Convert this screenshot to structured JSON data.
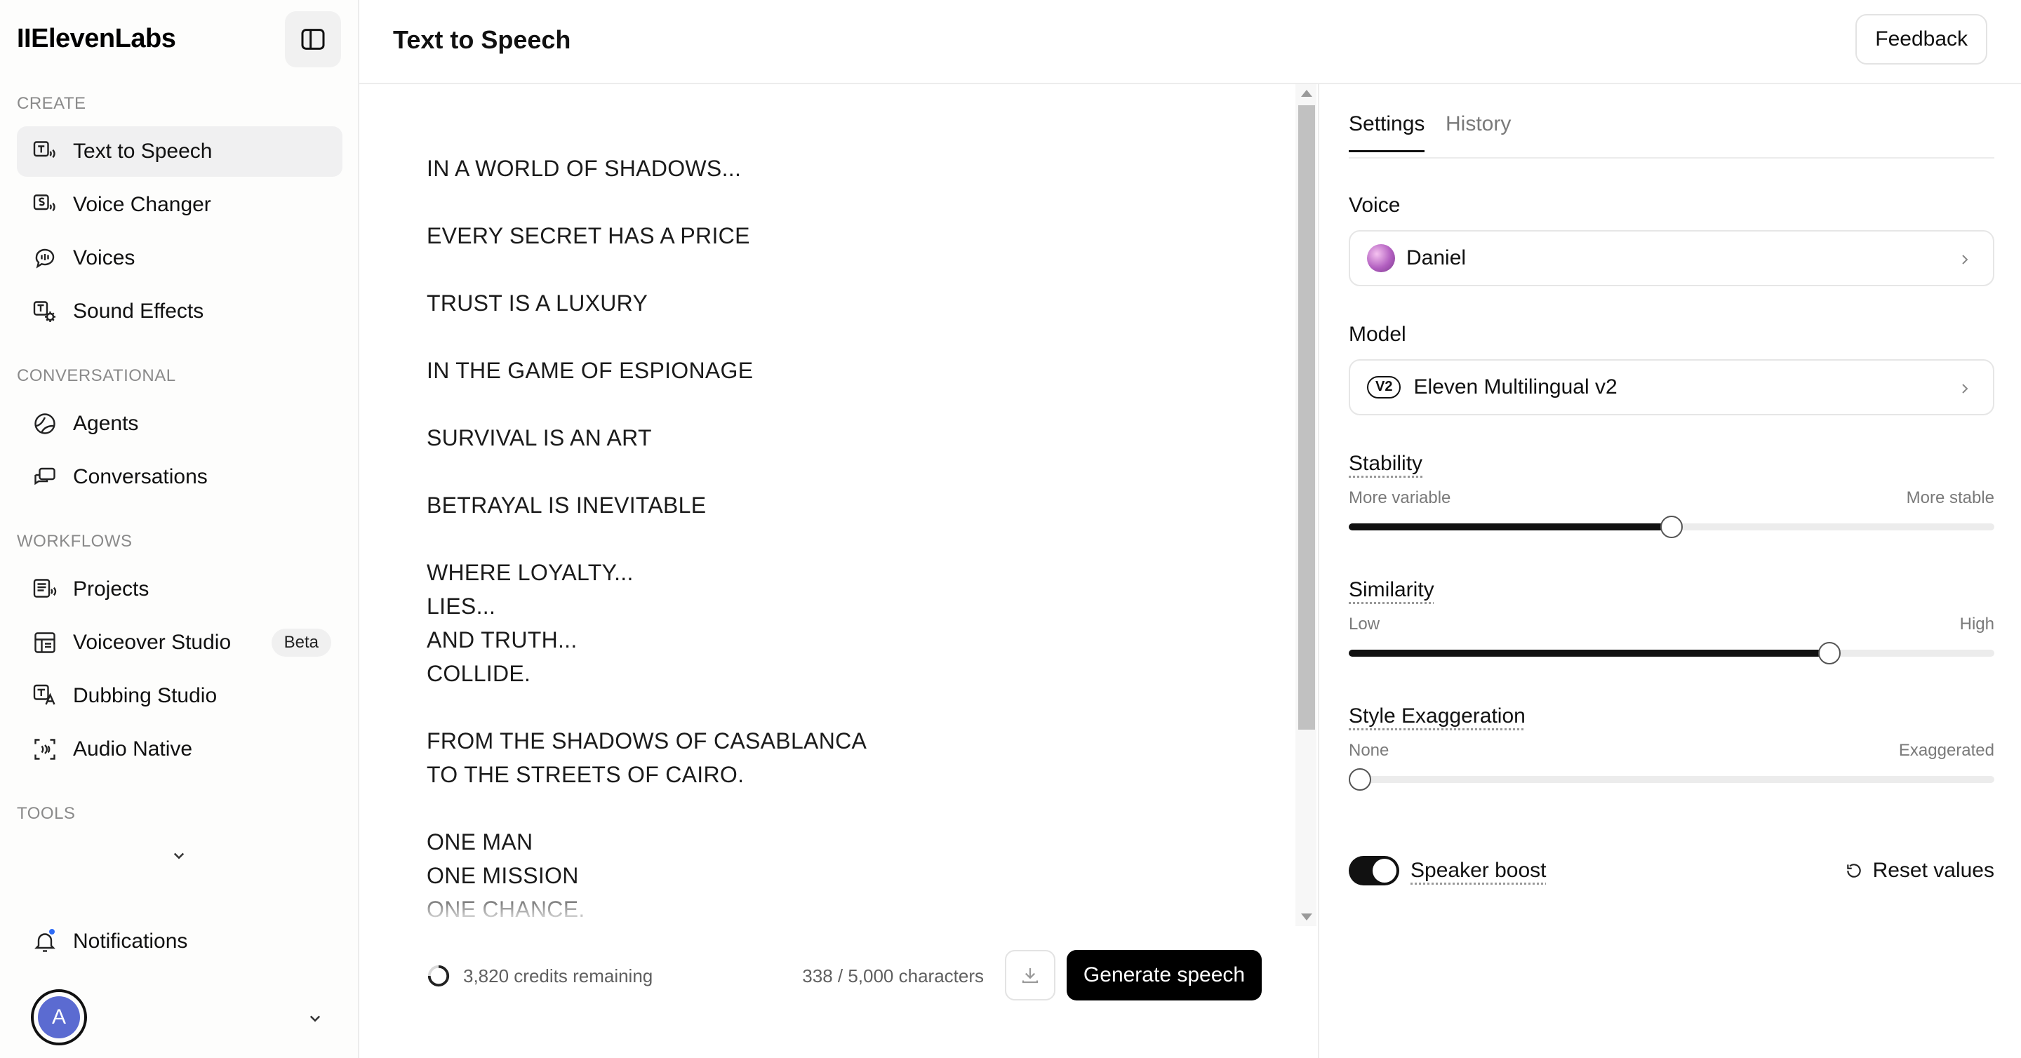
{
  "app": {
    "logo": "IIElevenLabs"
  },
  "sidebar": {
    "sections": [
      {
        "label": "CREATE"
      },
      {
        "label": "CONVERSATIONAL"
      },
      {
        "label": "WORKFLOWS"
      },
      {
        "label": "TOOLS"
      }
    ],
    "items": [
      {
        "label": "Text to Speech",
        "icon": "text-to-speech-icon"
      },
      {
        "label": "Voice Changer",
        "icon": "voice-changer-icon"
      },
      {
        "label": "Voices",
        "icon": "voices-icon"
      },
      {
        "label": "Sound Effects",
        "icon": "sound-effects-icon"
      },
      {
        "label": "Agents",
        "icon": "agents-icon"
      },
      {
        "label": "Conversations",
        "icon": "conversations-icon"
      },
      {
        "label": "Projects",
        "icon": "projects-icon"
      },
      {
        "label": "Voiceover Studio",
        "icon": "voiceover-studio-icon",
        "badge": "Beta"
      },
      {
        "label": "Dubbing Studio",
        "icon": "dubbing-studio-icon"
      },
      {
        "label": "Audio Native",
        "icon": "audio-native-icon"
      }
    ],
    "notifications_label": "Notifications",
    "avatar_initial": "A"
  },
  "header": {
    "title": "Text to Speech",
    "feedback_label": "Feedback"
  },
  "editor": {
    "text": "IN A WORLD OF SHADOWS...\n\nEVERY SECRET HAS A PRICE\n\nTRUST IS A LUXURY\n\nIN THE GAME OF ESPIONAGE\n\nSURVIVAL IS AN ART\n\nBETRAYAL IS INEVITABLE\n\nWHERE LOYALTY...\nLIES...\nAND TRUTH...\nCOLLIDE.\n\nFROM THE SHADOWS OF CASABLANCA\nTO THE STREETS OF CAIRO.\n\nONE MAN\nONE MISSION\nONE CHANCE.",
    "credits": "3,820 credits remaining",
    "char_count": "338 / 5,000 characters",
    "generate_label": "Generate speech"
  },
  "settings": {
    "tabs": [
      "Settings",
      "History"
    ],
    "active_tab": "Settings",
    "voice_label": "Voice",
    "voice_value": "Daniel",
    "model_label": "Model",
    "model_badge": "V2",
    "model_value": "Eleven Multilingual v2",
    "sliders": [
      {
        "label": "Stability",
        "min_label": "More variable",
        "max_label": "More stable",
        "value": 0.5
      },
      {
        "label": "Similarity",
        "min_label": "Low",
        "max_label": "High",
        "value": 0.745
      },
      {
        "label": "Style Exaggeration",
        "min_label": "None",
        "max_label": "Exaggerated",
        "value": 0.0
      }
    ],
    "speaker_boost_label": "Speaker boost",
    "speaker_boost_on": true,
    "reset_label": "Reset values"
  }
}
